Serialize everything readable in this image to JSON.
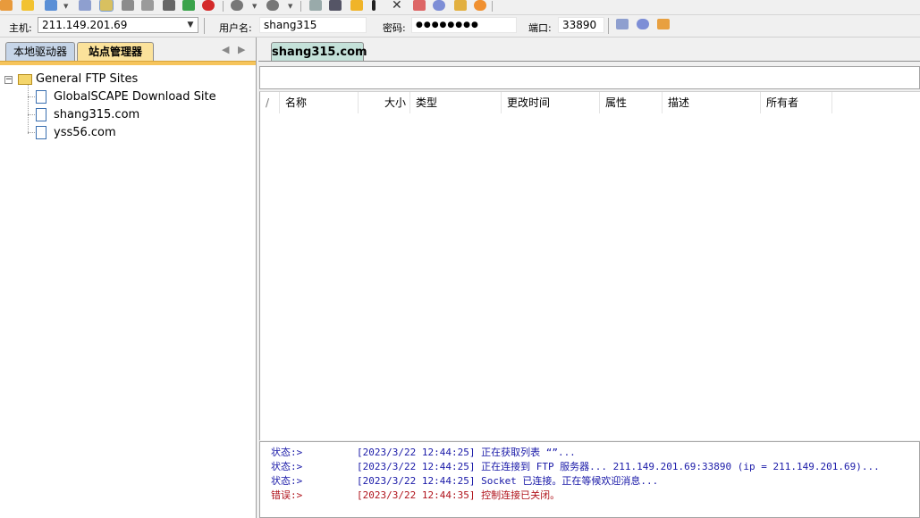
{
  "toolbar": {
    "icons": [
      "connect-icon",
      "quick-connect-icon",
      "new-icon",
      "disconnect-icon",
      "site-manager-icon",
      "pin-icon",
      "trace-icon",
      "binary-icon",
      "refresh-icon",
      "stop-icon",
      "download-icon",
      "upload-icon",
      "edit-icon",
      "compare-icon",
      "new-folder-icon",
      "mark-icon",
      "delete-icon",
      "checklist-icon",
      "settings-icon",
      "favorite-icon",
      "fire-icon"
    ]
  },
  "connection": {
    "host_label": "主机:",
    "host_value": "211.149.201.69",
    "user_label": "用户名:",
    "user_value": "shang315",
    "password_label": "密码:",
    "password_value": "●●●●●●●●",
    "port_label": "端口:",
    "port_value": "33890"
  },
  "left_panel": {
    "tabs": [
      "本地驱动器",
      "站点管理器"
    ],
    "active_tab": "站点管理器",
    "tree": {
      "root": "General FTP Sites",
      "children": [
        "GlobalSCAPE Download Site",
        "shang315.com",
        "yss56.com"
      ]
    }
  },
  "right_panel": {
    "tab_label": "shang315.com",
    "path": "",
    "columns": [
      "/",
      "名称",
      "大小",
      "类型",
      "更改时间",
      "属性",
      "描述",
      "所有者"
    ],
    "rows": []
  },
  "log": [
    {
      "label": "状态:>",
      "text": "[2023/3/22 12:44:25] 正在获取列表 “”...",
      "color": "#1a1aa8"
    },
    {
      "label": "状态:>",
      "text": "[2023/3/22 12:44:25] 正在连接到 FTP 服务器... 211.149.201.69:33890 (ip = 211.149.201.69)...",
      "color": "#1a1aa8"
    },
    {
      "label": "状态:>",
      "text": "[2023/3/22 12:44:25] Socket 已连接。正在等候欢迎消息...",
      "color": "#1a1aa8"
    },
    {
      "label": "错误:>",
      "text": "[2023/3/22 12:44:35] 控制连接已关闭。",
      "color": "#b0141c"
    }
  ],
  "colors": {
    "site_tab": "#fbe29b",
    "local_tab": "#c6d5e8",
    "remote_tab": "#c4e1d9",
    "status_text": "#1a1aa8",
    "error_text": "#b0141c"
  }
}
